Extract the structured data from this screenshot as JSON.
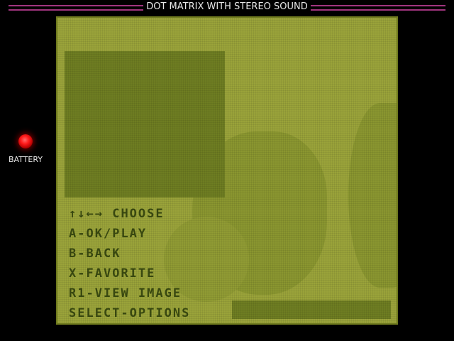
{
  "header": {
    "title": "DOT MATRIX WITH STEREO SOUND"
  },
  "battery": {
    "label": "BATTERY",
    "indicator_color": "#ff2020"
  },
  "screen": {
    "background_color": "#9aa33a",
    "menu": [
      {
        "key": "↑↓←→",
        "action": "CHOOSE"
      },
      {
        "key": "A",
        "action": "OK/PLAY"
      },
      {
        "key": "B",
        "action": "BACK"
      },
      {
        "key": "X",
        "action": "FAVORITE"
      },
      {
        "key": "R1",
        "action": "VIEW IMAGE"
      },
      {
        "key": "SELECT",
        "action": "OPTIONS"
      }
    ]
  }
}
